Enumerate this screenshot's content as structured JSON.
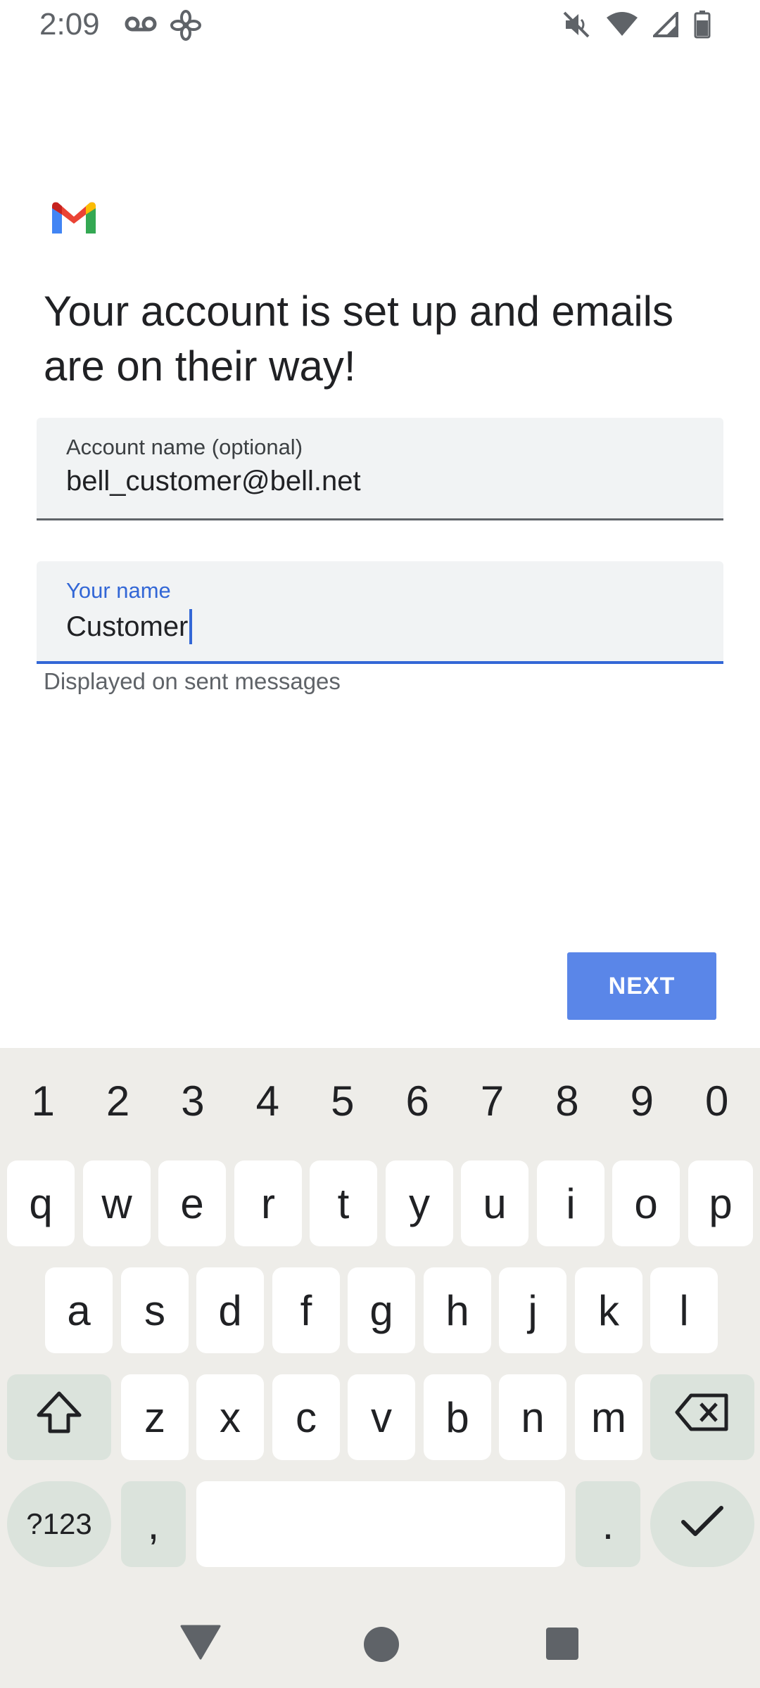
{
  "status_bar": {
    "time": "2:09",
    "left_icons": [
      "voicemail-icon",
      "fan-icon"
    ],
    "right_icons": [
      "mute-icon",
      "wifi-icon",
      "signal-icon",
      "battery-icon"
    ]
  },
  "app": {
    "logo": "gmail-logo-icon"
  },
  "headline": "Your account is set up and emails are on their way!",
  "account_field": {
    "label": "Account name (optional)",
    "value": "bell_customer@bell.net"
  },
  "name_field": {
    "label": "Your name",
    "value": "Customer",
    "helper": "Displayed on sent messages"
  },
  "next_button": {
    "label": "NEXT"
  },
  "colors": {
    "accent": "#3367d6",
    "button": "#5a86e8",
    "keyboard_bg": "#eeede9",
    "special_key": "#dbe3dc"
  },
  "keyboard": {
    "numbers": [
      "1",
      "2",
      "3",
      "4",
      "5",
      "6",
      "7",
      "8",
      "9",
      "0"
    ],
    "row1": [
      "q",
      "w",
      "e",
      "r",
      "t",
      "y",
      "u",
      "i",
      "o",
      "p"
    ],
    "row2": [
      "a",
      "s",
      "d",
      "f",
      "g",
      "h",
      "j",
      "k",
      "l"
    ],
    "row3": [
      "z",
      "x",
      "c",
      "v",
      "b",
      "n",
      "m"
    ],
    "symbols_label": "?123",
    "comma": ",",
    "period": ".",
    "shift_icon": "shift-icon",
    "backspace_icon": "backspace-icon",
    "enter_icon": "checkmark-icon"
  },
  "nav_bar": {
    "icons": [
      "back-icon",
      "home-icon",
      "recents-icon"
    ]
  }
}
